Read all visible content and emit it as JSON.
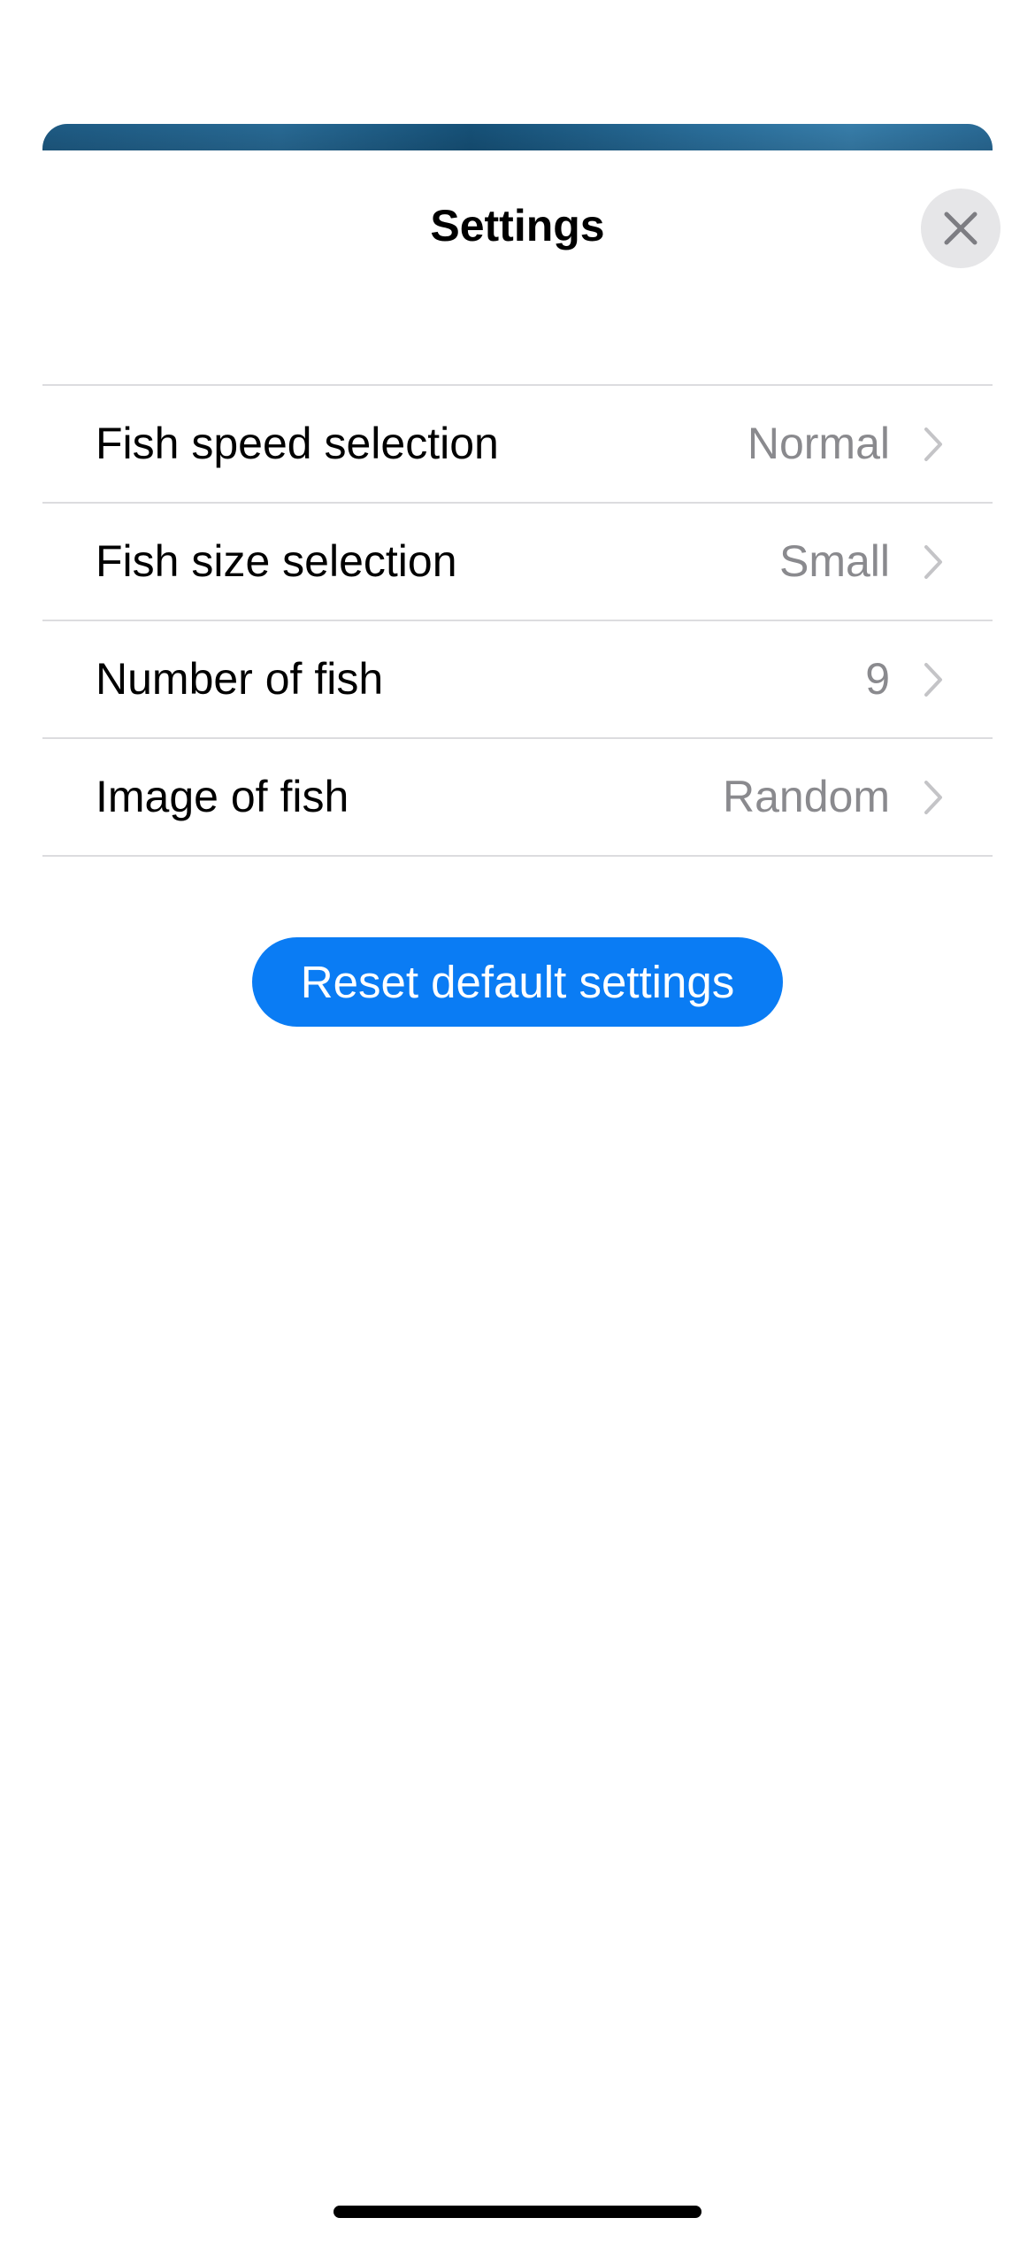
{
  "header": {
    "title": "Settings",
    "close_icon": "close-icon"
  },
  "settings": [
    {
      "label": "Fish speed selection",
      "value": "Normal"
    },
    {
      "label": "Fish size selection",
      "value": "Small"
    },
    {
      "label": "Number of fish",
      "value": "9"
    },
    {
      "label": "Image of fish",
      "value": "Random"
    }
  ],
  "reset_button": {
    "label": "Reset default settings"
  },
  "colors": {
    "accent": "#0a7cf4",
    "secondary_text": "#8a8a8e",
    "separator": "#dcdcdf",
    "close_button_bg": "#e6e6e8",
    "sheet_behind": "#2a6f9c"
  }
}
